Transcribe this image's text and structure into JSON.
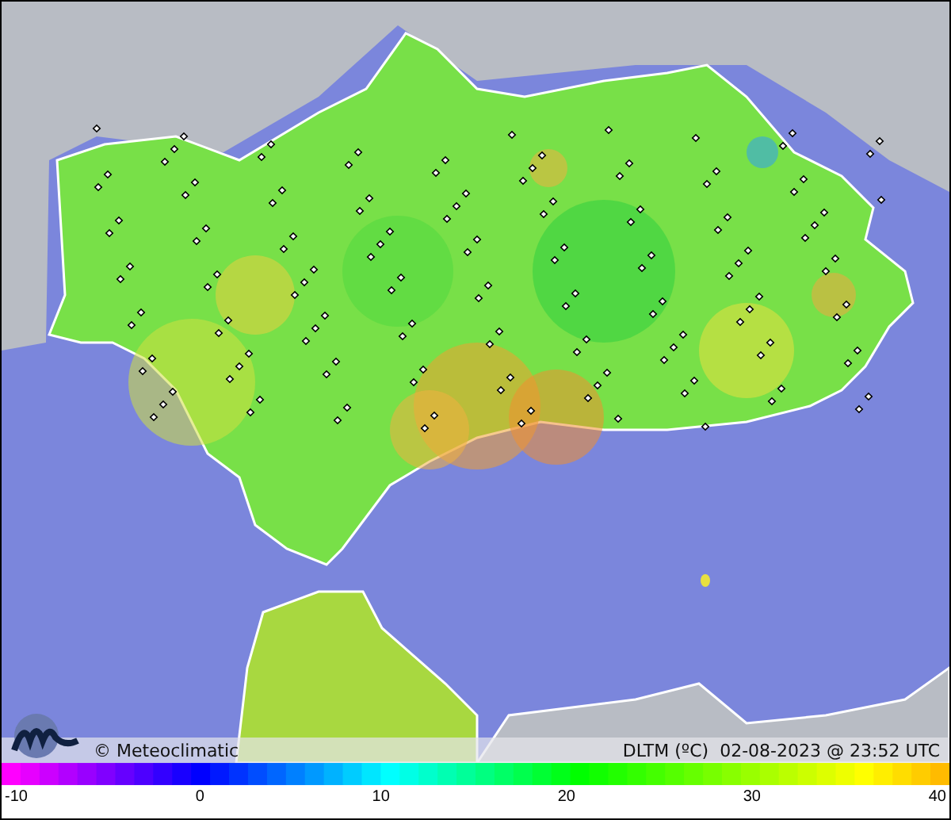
{
  "map": {
    "credit": "© Meteoclimatic",
    "caption": "DLTM (ºC)  02-08-2023 @ 23:52 UTC"
  },
  "legend": {
    "ticks": [
      "-10",
      "0",
      "10",
      "20",
      "30",
      "40"
    ]
  }
}
